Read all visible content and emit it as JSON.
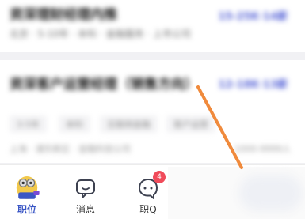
{
  "list": {
    "job1": {
      "title": "资深理财经理内推",
      "subtitle": "北京 · 5-10年 · 本科 · 金融服务 · 上市公司",
      "salary": "15-25K·14薪"
    },
    "job2": {
      "title": "资深客户运营经理（销售方向）",
      "salary": "12-18K·13薪",
      "tags": [
        "3-5年",
        "本科",
        "互联网金融",
        "客户运营"
      ],
      "info_left": "上海 · 浦东新区 · 金融科技公司",
      "info_right": "1000-9999人"
    }
  },
  "tabs": [
    {
      "label": "职位",
      "icon": "mascot-icon",
      "active": true
    },
    {
      "label": "消息",
      "icon": "chat-bubble-icon",
      "active": false
    },
    {
      "label": "职Q",
      "icon": "q-bubble-icon",
      "active": false,
      "badge": "4"
    }
  ],
  "colors": {
    "accent": "#3a56c5",
    "arrow": "#f08a3c",
    "badge": "#f04b5a"
  }
}
